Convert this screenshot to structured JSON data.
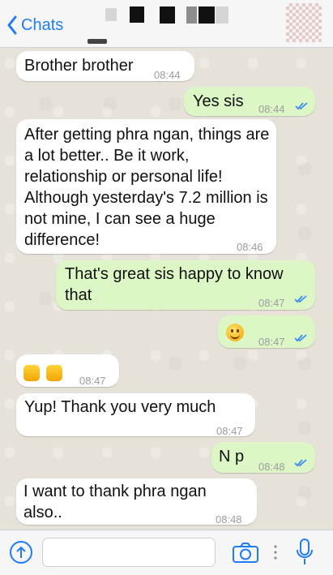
{
  "header": {
    "back_label": "Chats"
  },
  "messages": [
    {
      "direction": "in",
      "text": "Brother brother",
      "time": "08:44"
    },
    {
      "direction": "out",
      "text": "Yes sis",
      "time": "08:44",
      "status": "read"
    },
    {
      "direction": "in",
      "text": "After getting phra ngan, things are a lot better.. Be it work, relationship or personal life! Although yesterday's 7.2 million is not mine, I can see a huge difference!",
      "time": "08:46"
    },
    {
      "direction": "out",
      "text": "That's great sis happy to know that",
      "time": "08:47",
      "status": "read"
    },
    {
      "direction": "out",
      "emoji": "smiley-face",
      "time": "08:47",
      "status": "read"
    },
    {
      "direction": "in",
      "emoji": "two-thumbs-up",
      "time": "08:47"
    },
    {
      "direction": "in",
      "text": "Yup! Thank you very much",
      "time": "08:47"
    },
    {
      "direction": "out",
      "text": "N p",
      "time": "08:48",
      "status": "read"
    },
    {
      "direction": "in",
      "text": "I want to thank phra ngan also..",
      "time": "08:48"
    }
  ],
  "composer": {
    "placeholder": ""
  },
  "colors": {
    "accent": "#1f7cf5",
    "outgoing_bubble": "#dcf7c5",
    "incoming_bubble": "#ffffff",
    "read_ticks": "#3d8ef0"
  },
  "icons": [
    "chevron-left-icon",
    "upload-icon",
    "camera-icon",
    "more-icon",
    "microphone-icon",
    "double-check-icon"
  ]
}
